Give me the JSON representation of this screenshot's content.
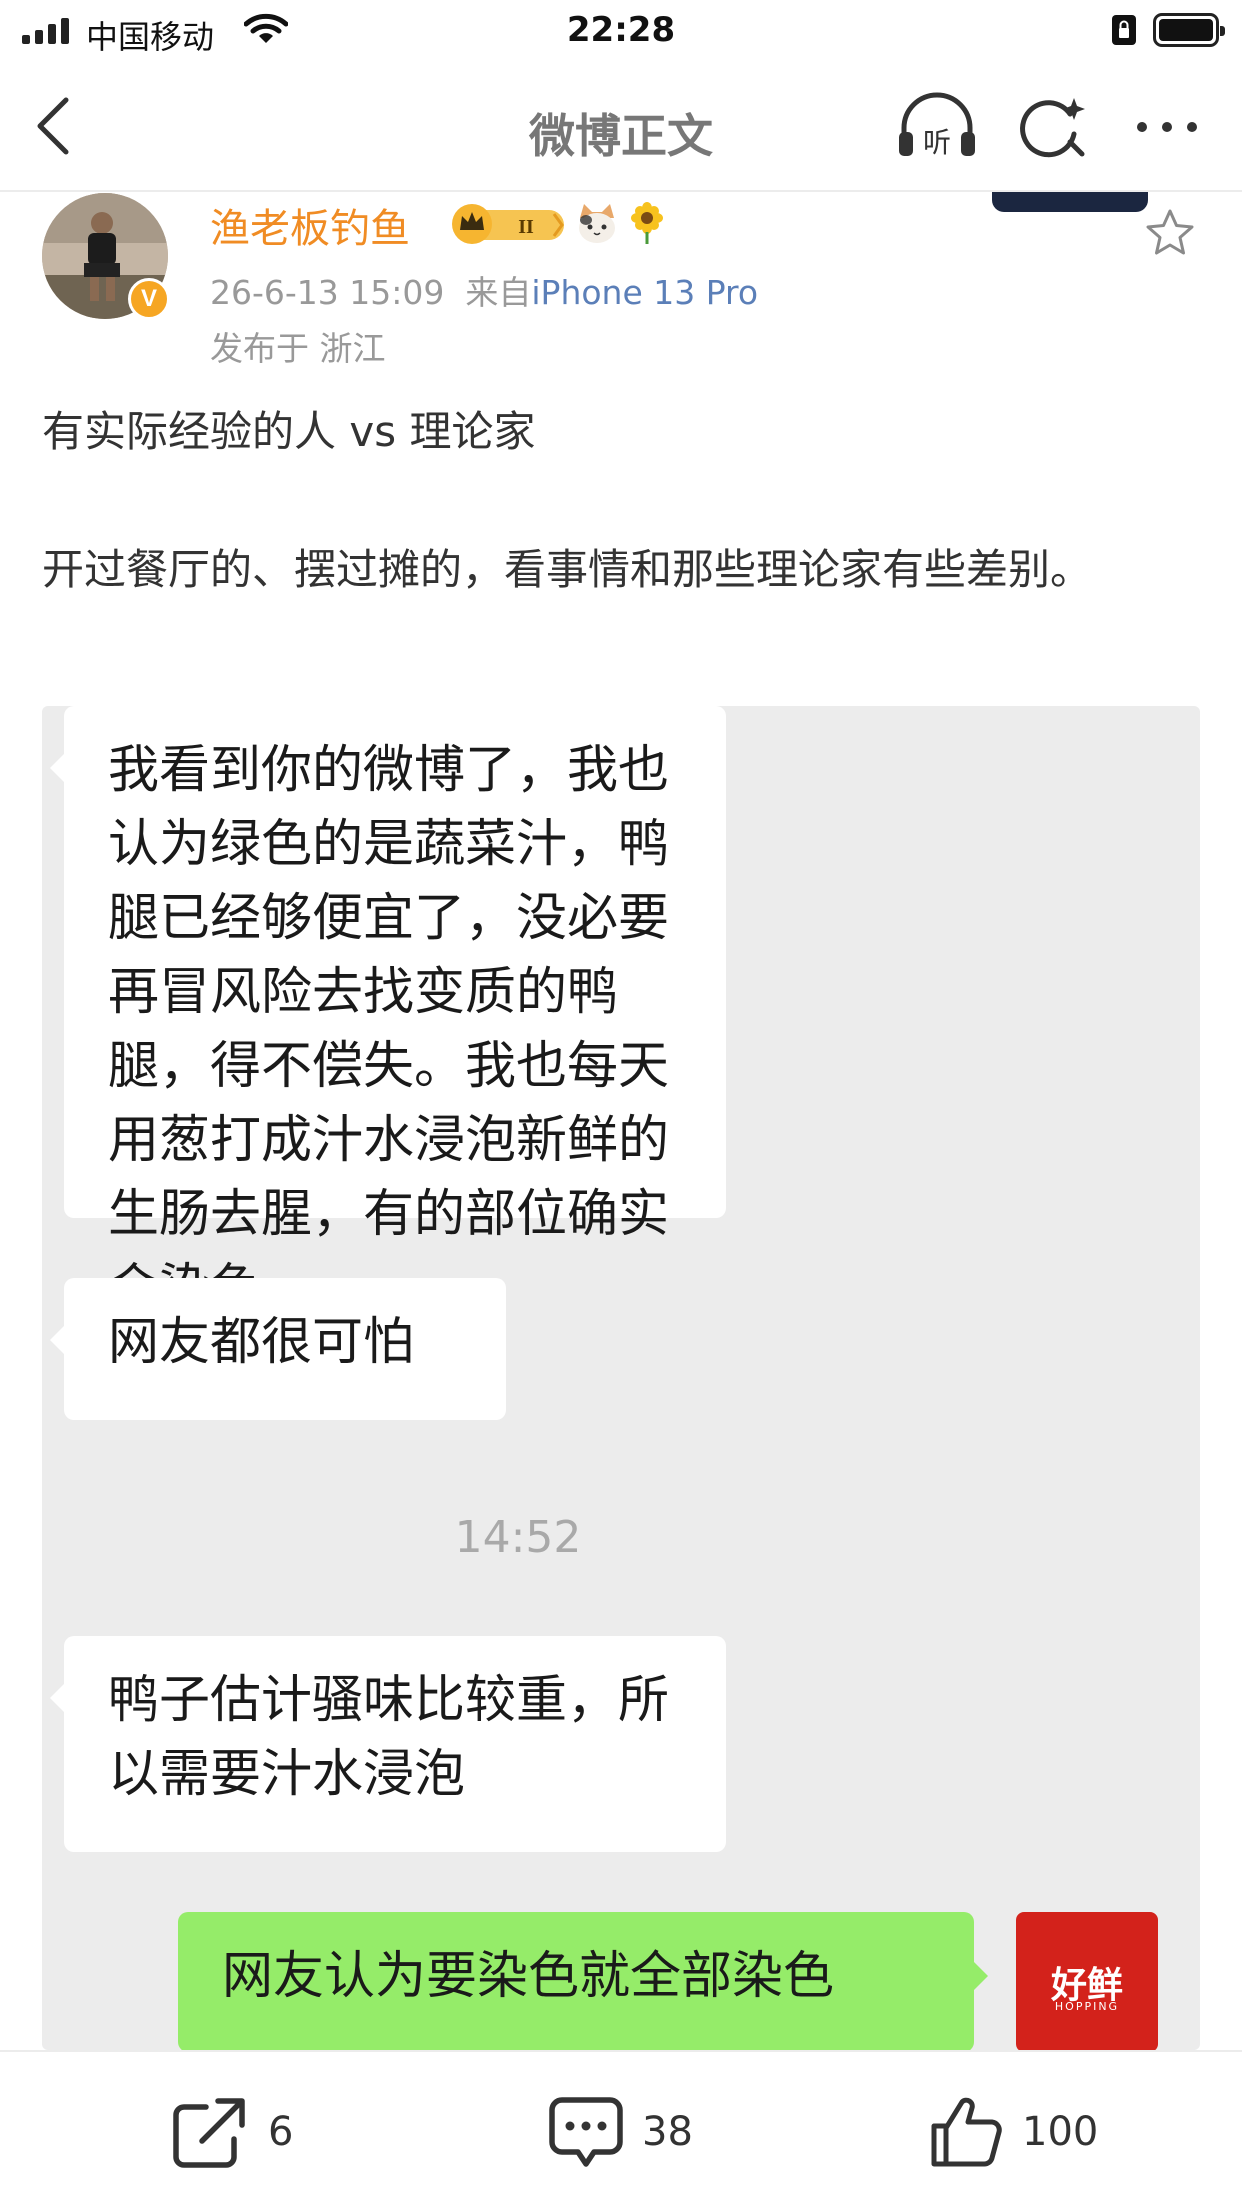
{
  "status_bar": {
    "carrier": "中国移动",
    "time": "22:28"
  },
  "nav": {
    "title": "微博正文",
    "icons": [
      "back-icon",
      "listen-icon",
      "search-sparkle-icon",
      "more-icon"
    ]
  },
  "post": {
    "author": "渔老板钓鱼",
    "verified_badge": "V",
    "timestamp": "26-6-13 15:09",
    "source_prefix": "来自",
    "device": "iPhone 13 Pro",
    "location": "发布于 浙江",
    "paragraphs": [
      "有实际经验的人 vs 理论家",
      "开过餐厅的、摆过摊的，看事情和那些理论家有些差别。"
    ]
  },
  "chat_image": {
    "messages": [
      {
        "side": "left",
        "text": "我看到你的微博了，我也认为绿色的是蔬菜汁，鸭腿已经够便宜了，没必要再冒风险去找变质的鸭腿，得不偿失。我也每天用葱打成汁水浸泡新鲜的生肠去腥，有的部位确实会染色。"
      },
      {
        "side": "left",
        "text": "网友都很可怕"
      },
      {
        "side": "left",
        "text": "鸭子估计骚味比较重，所以需要汁水浸泡"
      },
      {
        "side": "right",
        "text": "网友认为要染色就全部染色"
      }
    ],
    "time_divider": "14:52",
    "avatar_logo_cn": "好鲜",
    "avatar_logo_en": "HOPPING",
    "bubble_colors": {
      "received": "#ffffff",
      "sent": "#95ec69",
      "background": "#ececec"
    }
  },
  "bottom_bar": {
    "share_count": "6",
    "comment_count": "38",
    "like_count": "100"
  },
  "colors": {
    "author_name": "#f08c24",
    "device_link": "#5b7fb8",
    "verified": "#f6a623"
  }
}
